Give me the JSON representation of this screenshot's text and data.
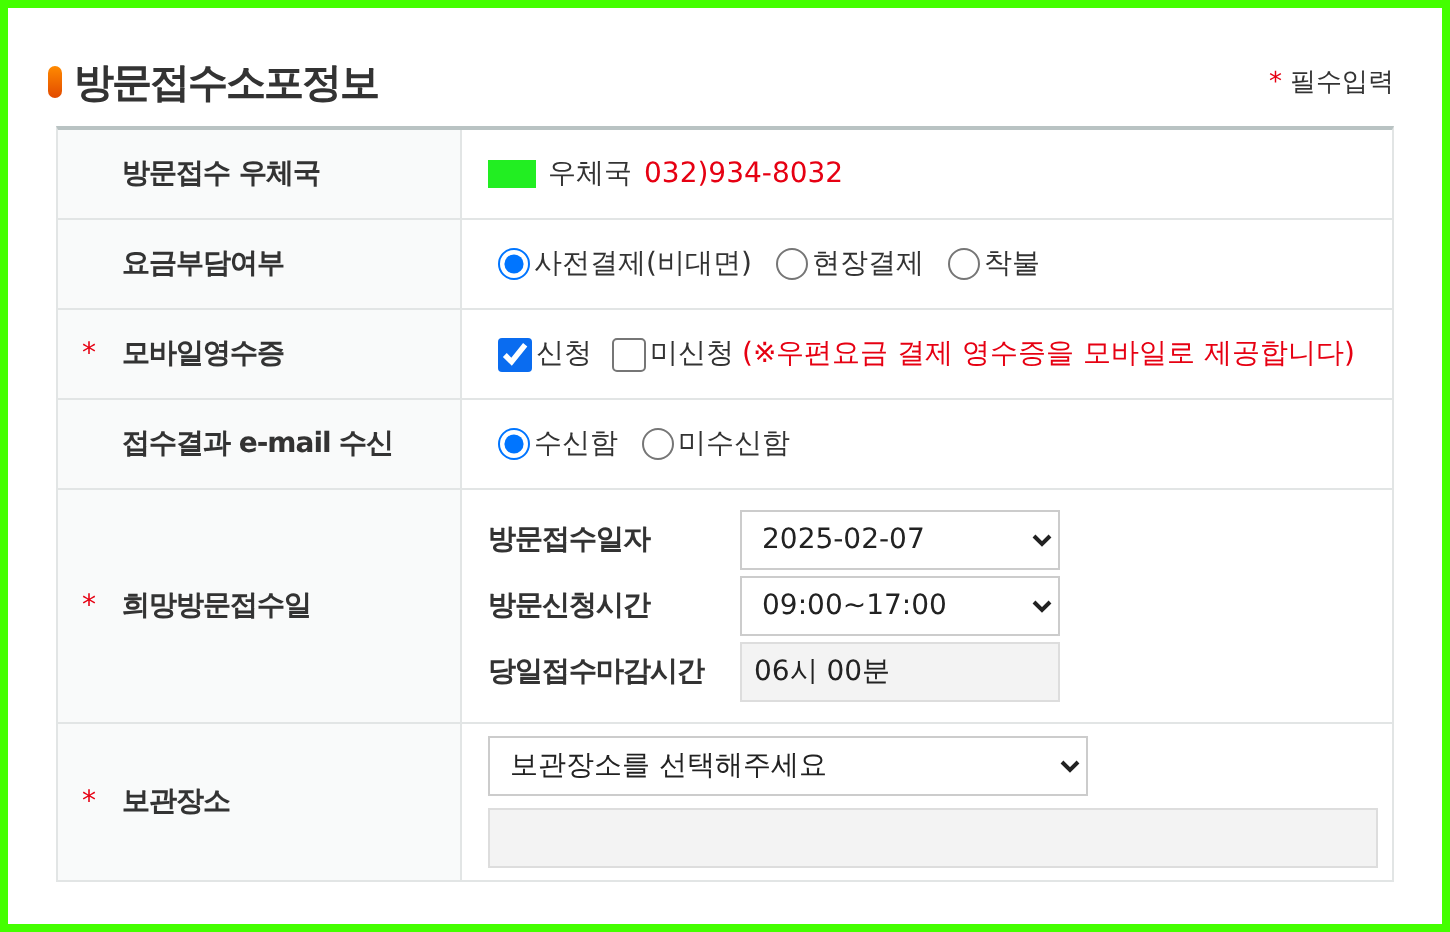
{
  "title": "방문접수소포정보",
  "required_note": {
    "mark": "*",
    "text": "필수입력"
  },
  "rows": [
    {
      "kind": "office",
      "label": "방문접수 우체국",
      "redacted": true,
      "office_name": "우체국",
      "phone": "032)934-8032"
    },
    {
      "kind": "radio",
      "label": "요금부담여부",
      "options": [
        {
          "label": "사전결제(비대면)",
          "selected": true
        },
        {
          "label": "현장결제",
          "selected": false
        },
        {
          "label": "착불",
          "selected": false
        }
      ]
    },
    {
      "kind": "checkbox",
      "mark": "*",
      "label": "모바일영수증",
      "options": [
        {
          "label": "신청",
          "checked": true
        },
        {
          "label": "미신청",
          "checked": false
        }
      ],
      "notice": "(※우편요금 결제 영수증을 모바일로 제공합니다)"
    },
    {
      "kind": "radio",
      "label": "접수결과 e-mail 수신",
      "options": [
        {
          "label": "수신함",
          "selected": true
        },
        {
          "label": "미수신함",
          "selected": false
        }
      ]
    },
    {
      "kind": "fields",
      "mark": "*",
      "label": "희망방문접수일",
      "fields": [
        {
          "kind": "select",
          "label": "방문접수일자",
          "value": "2025-02-07"
        },
        {
          "kind": "select",
          "label": "방문신청시간",
          "value": "09:00~17:00"
        },
        {
          "kind": "readonly",
          "label": "당일접수마감시간",
          "value": "06시 00분"
        }
      ]
    },
    {
      "kind": "storage",
      "mark": "*",
      "label": "보관장소",
      "select": {
        "value": "보관장소를 선택해주세요"
      },
      "detail_field": {
        "disabled": true
      }
    }
  ]
}
